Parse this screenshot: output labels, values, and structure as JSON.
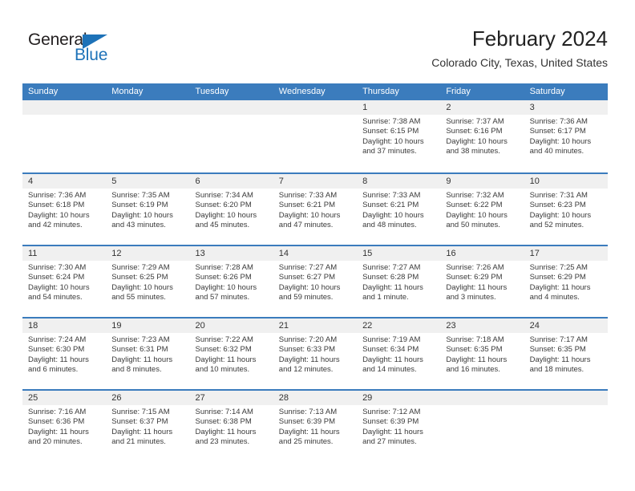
{
  "brand": {
    "name_top": "General",
    "name_bottom": "Blue",
    "triangle_color": "#1d72b8"
  },
  "header": {
    "title": "February 2024",
    "location": "Colorado City, Texas, United States"
  },
  "calendar": {
    "header_color": "#3b7cbd",
    "weekdays": [
      "Sunday",
      "Monday",
      "Tuesday",
      "Wednesday",
      "Thursday",
      "Friday",
      "Saturday"
    ],
    "weeks": [
      [
        {
          "day": "",
          "sunrise": "",
          "sunset": "",
          "daylight": "",
          "empty": true
        },
        {
          "day": "",
          "sunrise": "",
          "sunset": "",
          "daylight": "",
          "empty": true
        },
        {
          "day": "",
          "sunrise": "",
          "sunset": "",
          "daylight": "",
          "empty": true
        },
        {
          "day": "",
          "sunrise": "",
          "sunset": "",
          "daylight": "",
          "empty": true
        },
        {
          "day": "1",
          "sunrise": "Sunrise: 7:38 AM",
          "sunset": "Sunset: 6:15 PM",
          "daylight": "Daylight: 10 hours and 37 minutes."
        },
        {
          "day": "2",
          "sunrise": "Sunrise: 7:37 AM",
          "sunset": "Sunset: 6:16 PM",
          "daylight": "Daylight: 10 hours and 38 minutes."
        },
        {
          "day": "3",
          "sunrise": "Sunrise: 7:36 AM",
          "sunset": "Sunset: 6:17 PM",
          "daylight": "Daylight: 10 hours and 40 minutes."
        }
      ],
      [
        {
          "day": "4",
          "sunrise": "Sunrise: 7:36 AM",
          "sunset": "Sunset: 6:18 PM",
          "daylight": "Daylight: 10 hours and 42 minutes."
        },
        {
          "day": "5",
          "sunrise": "Sunrise: 7:35 AM",
          "sunset": "Sunset: 6:19 PM",
          "daylight": "Daylight: 10 hours and 43 minutes."
        },
        {
          "day": "6",
          "sunrise": "Sunrise: 7:34 AM",
          "sunset": "Sunset: 6:20 PM",
          "daylight": "Daylight: 10 hours and 45 minutes."
        },
        {
          "day": "7",
          "sunrise": "Sunrise: 7:33 AM",
          "sunset": "Sunset: 6:21 PM",
          "daylight": "Daylight: 10 hours and 47 minutes."
        },
        {
          "day": "8",
          "sunrise": "Sunrise: 7:33 AM",
          "sunset": "Sunset: 6:21 PM",
          "daylight": "Daylight: 10 hours and 48 minutes."
        },
        {
          "day": "9",
          "sunrise": "Sunrise: 7:32 AM",
          "sunset": "Sunset: 6:22 PM",
          "daylight": "Daylight: 10 hours and 50 minutes."
        },
        {
          "day": "10",
          "sunrise": "Sunrise: 7:31 AM",
          "sunset": "Sunset: 6:23 PM",
          "daylight": "Daylight: 10 hours and 52 minutes."
        }
      ],
      [
        {
          "day": "11",
          "sunrise": "Sunrise: 7:30 AM",
          "sunset": "Sunset: 6:24 PM",
          "daylight": "Daylight: 10 hours and 54 minutes."
        },
        {
          "day": "12",
          "sunrise": "Sunrise: 7:29 AM",
          "sunset": "Sunset: 6:25 PM",
          "daylight": "Daylight: 10 hours and 55 minutes."
        },
        {
          "day": "13",
          "sunrise": "Sunrise: 7:28 AM",
          "sunset": "Sunset: 6:26 PM",
          "daylight": "Daylight: 10 hours and 57 minutes."
        },
        {
          "day": "14",
          "sunrise": "Sunrise: 7:27 AM",
          "sunset": "Sunset: 6:27 PM",
          "daylight": "Daylight: 10 hours and 59 minutes."
        },
        {
          "day": "15",
          "sunrise": "Sunrise: 7:27 AM",
          "sunset": "Sunset: 6:28 PM",
          "daylight": "Daylight: 11 hours and 1 minute."
        },
        {
          "day": "16",
          "sunrise": "Sunrise: 7:26 AM",
          "sunset": "Sunset: 6:29 PM",
          "daylight": "Daylight: 11 hours and 3 minutes."
        },
        {
          "day": "17",
          "sunrise": "Sunrise: 7:25 AM",
          "sunset": "Sunset: 6:29 PM",
          "daylight": "Daylight: 11 hours and 4 minutes."
        }
      ],
      [
        {
          "day": "18",
          "sunrise": "Sunrise: 7:24 AM",
          "sunset": "Sunset: 6:30 PM",
          "daylight": "Daylight: 11 hours and 6 minutes."
        },
        {
          "day": "19",
          "sunrise": "Sunrise: 7:23 AM",
          "sunset": "Sunset: 6:31 PM",
          "daylight": "Daylight: 11 hours and 8 minutes."
        },
        {
          "day": "20",
          "sunrise": "Sunrise: 7:22 AM",
          "sunset": "Sunset: 6:32 PM",
          "daylight": "Daylight: 11 hours and 10 minutes."
        },
        {
          "day": "21",
          "sunrise": "Sunrise: 7:20 AM",
          "sunset": "Sunset: 6:33 PM",
          "daylight": "Daylight: 11 hours and 12 minutes."
        },
        {
          "day": "22",
          "sunrise": "Sunrise: 7:19 AM",
          "sunset": "Sunset: 6:34 PM",
          "daylight": "Daylight: 11 hours and 14 minutes."
        },
        {
          "day": "23",
          "sunrise": "Sunrise: 7:18 AM",
          "sunset": "Sunset: 6:35 PM",
          "daylight": "Daylight: 11 hours and 16 minutes."
        },
        {
          "day": "24",
          "sunrise": "Sunrise: 7:17 AM",
          "sunset": "Sunset: 6:35 PM",
          "daylight": "Daylight: 11 hours and 18 minutes."
        }
      ],
      [
        {
          "day": "25",
          "sunrise": "Sunrise: 7:16 AM",
          "sunset": "Sunset: 6:36 PM",
          "daylight": "Daylight: 11 hours and 20 minutes."
        },
        {
          "day": "26",
          "sunrise": "Sunrise: 7:15 AM",
          "sunset": "Sunset: 6:37 PM",
          "daylight": "Daylight: 11 hours and 21 minutes."
        },
        {
          "day": "27",
          "sunrise": "Sunrise: 7:14 AM",
          "sunset": "Sunset: 6:38 PM",
          "daylight": "Daylight: 11 hours and 23 minutes."
        },
        {
          "day": "28",
          "sunrise": "Sunrise: 7:13 AM",
          "sunset": "Sunset: 6:39 PM",
          "daylight": "Daylight: 11 hours and 25 minutes."
        },
        {
          "day": "29",
          "sunrise": "Sunrise: 7:12 AM",
          "sunset": "Sunset: 6:39 PM",
          "daylight": "Daylight: 11 hours and 27 minutes."
        },
        {
          "day": "",
          "sunrise": "",
          "sunset": "",
          "daylight": "",
          "empty": true
        },
        {
          "day": "",
          "sunrise": "",
          "sunset": "",
          "daylight": "",
          "empty": true
        }
      ]
    ]
  }
}
